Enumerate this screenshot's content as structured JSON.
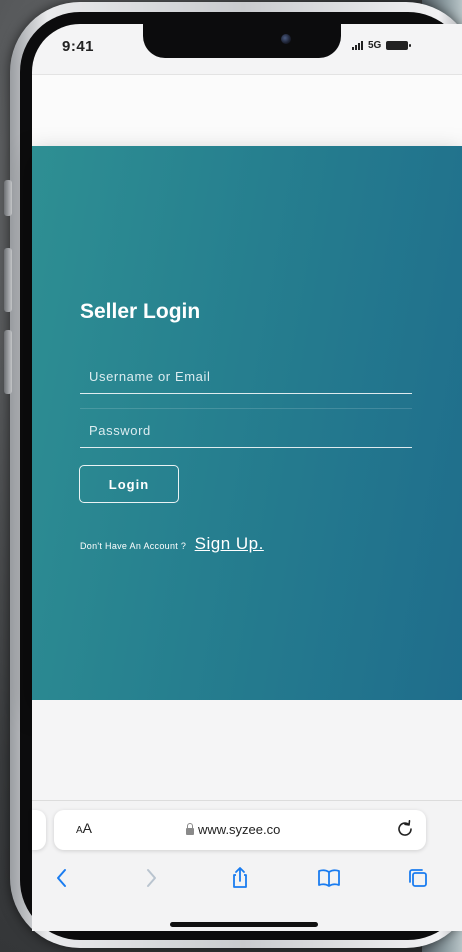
{
  "status_bar": {
    "time": "9:41",
    "network": "5G"
  },
  "login": {
    "title": "Seller Login",
    "username_placeholder": "Username or Email",
    "password_placeholder": "Password",
    "login_label": "Login",
    "signup_prompt": "Don't Have An Account ?",
    "signup_link": "Sign Up."
  },
  "browser": {
    "text_size_label_big": "A",
    "text_size_label_small": "A",
    "url": "www.syzee.co"
  },
  "colors": {
    "card_start": "#2e8f93",
    "card_end": "#1f6d8c",
    "accent_blue": "#1a7cf0"
  },
  "icons": {
    "back": "chevron-left-icon",
    "forward": "chevron-right-icon",
    "share": "share-icon",
    "bookmarks": "book-icon",
    "tabs": "tabs-icon",
    "reload": "reload-icon",
    "lock": "lock-icon"
  }
}
